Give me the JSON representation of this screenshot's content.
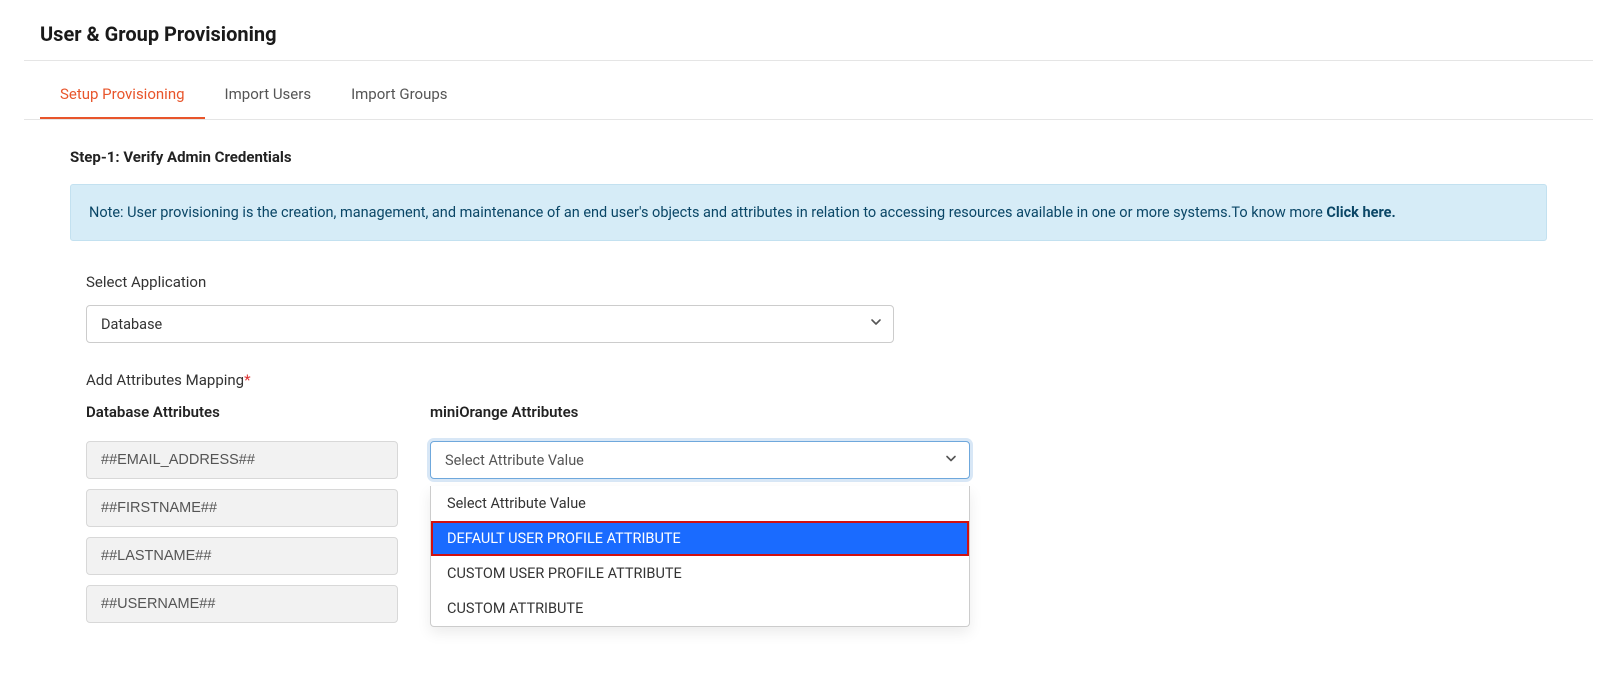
{
  "page_title": "User & Group Provisioning",
  "tabs": [
    {
      "label": "Setup Provisioning",
      "active": true
    },
    {
      "label": "Import Users",
      "active": false
    },
    {
      "label": "Import Groups",
      "active": false
    }
  ],
  "step_heading": "Step-1: Verify Admin Credentials",
  "info_note_prefix": "Note: User provisioning is the creation, management, and maintenance of an end user's objects and attributes in relation to accessing resources available in one or more systems.To know more ",
  "info_note_link": "Click here.",
  "select_application_label": "Select Application",
  "select_application_value": "Database",
  "add_attributes_label": "Add Attributes Mapping",
  "columns": {
    "left": "Database Attributes",
    "right": "miniOrange Attributes"
  },
  "db_attributes": [
    "##EMAIL_ADDRESS##",
    "##FIRSTNAME##",
    "##LASTNAME##",
    "##USERNAME##"
  ],
  "attr_placeholder": "Select Attribute Value",
  "dropdown_options": [
    "Select Attribute Value",
    "DEFAULT USER PROFILE ATTRIBUTE",
    "CUSTOM USER PROFILE ATTRIBUTE",
    "CUSTOM ATTRIBUTE"
  ],
  "dropdown_highlighted_index": 1
}
